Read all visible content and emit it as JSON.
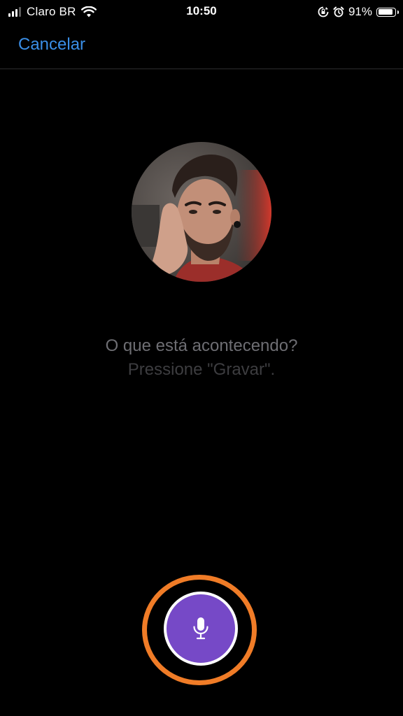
{
  "status_bar": {
    "carrier": "Claro BR",
    "time": "10:50",
    "battery_percent": "91%",
    "battery_level": 0.91,
    "signal_bars_active": 3,
    "signal_bars_total": 4,
    "icons": [
      "signal-icon",
      "wifi-icon",
      "orientation-lock-icon",
      "alarm-icon",
      "battery-icon"
    ]
  },
  "nav": {
    "cancel_label": "Cancelar"
  },
  "profile": {
    "avatar_icon": "user-photo"
  },
  "prompt": {
    "title": "O que está acontecendo?",
    "subtitle": "Pressione \"Gravar\"."
  },
  "record": {
    "icon": "microphone-icon",
    "button_color": "#7649c7",
    "highlight_color": "#f07c27"
  },
  "colors": {
    "background": "#000000",
    "accent": "#3a8ee6"
  }
}
